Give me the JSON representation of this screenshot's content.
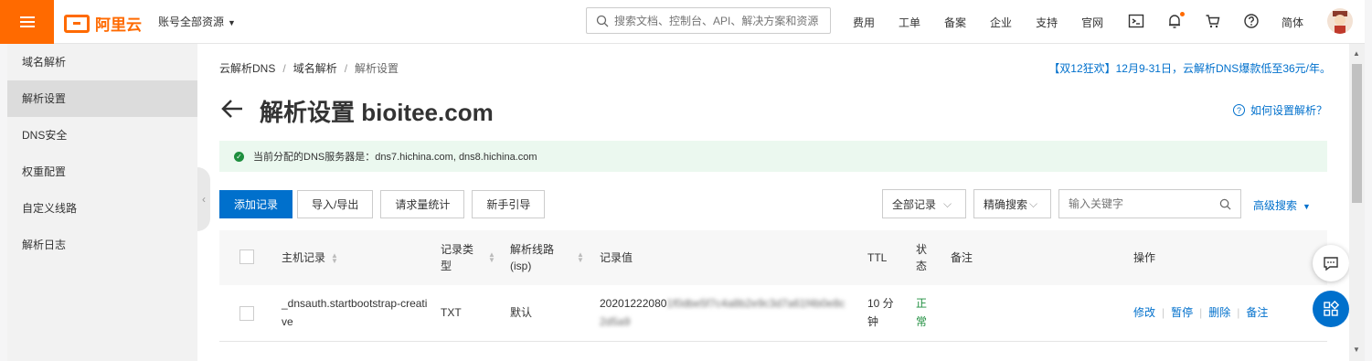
{
  "topbar": {
    "logo_text": "阿里云",
    "account_label": "账号全部资源",
    "search_placeholder": "搜索文档、控制台、API、解决方案和资源",
    "links": [
      "费用",
      "工单",
      "备案",
      "企业",
      "支持",
      "官网"
    ],
    "lang": "简体",
    "accent_color": "#ff6a00"
  },
  "sidebar": {
    "items": [
      {
        "label": "域名解析"
      },
      {
        "label": "解析设置"
      },
      {
        "label": "DNS安全"
      },
      {
        "label": "权重配置"
      },
      {
        "label": "自定义线路"
      },
      {
        "label": "解析日志"
      }
    ]
  },
  "main": {
    "breadcrumb": [
      "云解析DNS",
      "域名解析",
      "解析设置"
    ],
    "promo": "【双12狂欢】12月9-31日，云解析DNS爆款低至36元/年。",
    "title": "解析设置 bioitee.com",
    "help_link": "如何设置解析？",
    "notice": "当前分配的DNS服务器是：dns7.hichina.com, dns8.hichina.com",
    "toolbar": {
      "add": "添加记录",
      "import_export": "导入/导出",
      "request_stats": "请求量统计",
      "guide": "新手引导"
    },
    "filters": {
      "records": "全部记录",
      "exact": "精确搜索",
      "keyword_placeholder": "输入关键字",
      "advanced": "高级搜索"
    },
    "table": {
      "headers": {
        "host": "主机记录",
        "type": "记录类型",
        "line": "解析线路(isp)",
        "value": "记录值",
        "ttl": "TTL",
        "status": "状态",
        "remark": "备注",
        "ops": "操作"
      },
      "rows": [
        {
          "host": "_dnsauth.startbootstrap-creative",
          "type": "TXT",
          "line": "默认",
          "value_prefix": "20201222080",
          "value_hidden": "1f0dbe5f7c4a8b2e9c3d7a61f4b0e8c2d5a9",
          "ttl": "10 分钟",
          "status": "正常",
          "ops": [
            "修改",
            "暂停",
            "删除",
            "备注"
          ]
        }
      ]
    }
  },
  "colors": {
    "primary": "#0070cc",
    "success": "#1e8e3e",
    "notice_bg": "#ebf8ef"
  }
}
